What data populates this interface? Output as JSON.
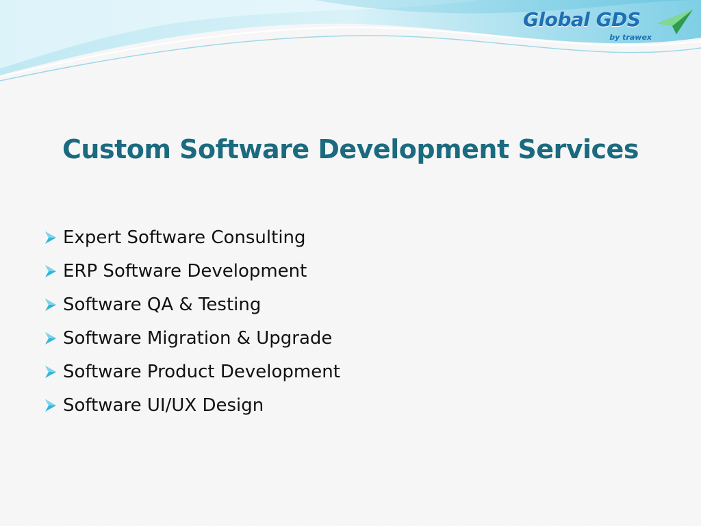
{
  "logo": {
    "name": "Global GDS",
    "tagline": "by trawex"
  },
  "slide": {
    "title": "Custom Software Development Services",
    "bullets": [
      "Expert Software Consulting",
      "ERP Software Development",
      "Software QA & Testing",
      "Software Migration & Upgrade",
      "Software Product Development",
      "Software UI/UX Design"
    ]
  },
  "colors": {
    "title": "#1b6a7f",
    "bullet_arrow": "#33b5d6",
    "logo": "#1f6fb3",
    "header_wave": "#8fd6ea"
  },
  "icons": {
    "bullet": "arrow-bullet-icon",
    "logo": "paper-plane-icon"
  }
}
